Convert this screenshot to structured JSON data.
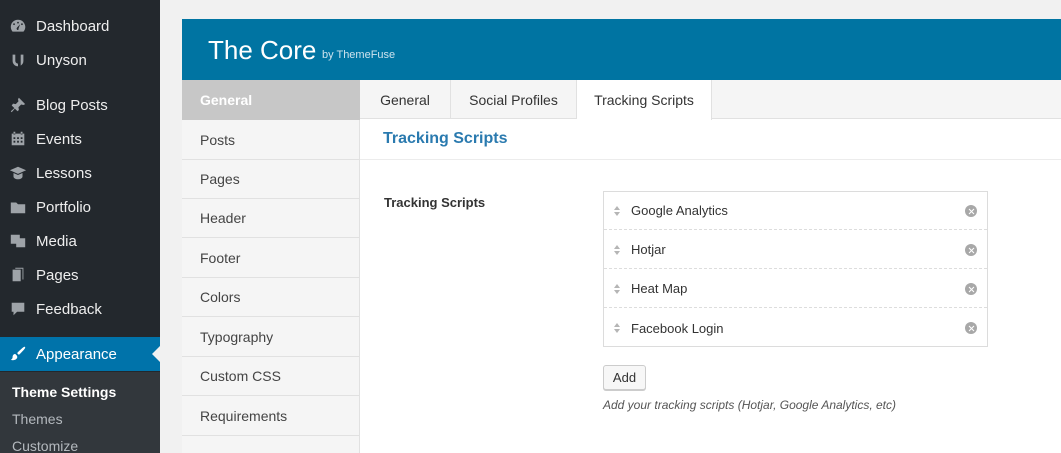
{
  "wp_menu": {
    "items": [
      {
        "label": "Dashboard",
        "icon": "dashboard-icon"
      },
      {
        "label": "Unyson",
        "icon": "unyson-icon"
      },
      {
        "label": "Blog Posts",
        "icon": "pin-icon"
      },
      {
        "label": "Events",
        "icon": "calendar-icon"
      },
      {
        "label": "Lessons",
        "icon": "graduation-cap-icon"
      },
      {
        "label": "Portfolio",
        "icon": "folder-icon"
      },
      {
        "label": "Media",
        "icon": "media-icon"
      },
      {
        "label": "Pages",
        "icon": "pages-icon"
      },
      {
        "label": "Feedback",
        "icon": "comment-icon"
      },
      {
        "label": "Appearance",
        "icon": "paintbrush-icon"
      }
    ],
    "submenu": [
      "Theme Settings",
      "Themes",
      "Customize"
    ],
    "active_color": "#0073aa"
  },
  "panel": {
    "title": "The Core",
    "subtitle": "by ThemeFuse",
    "header_color": "#0074a2",
    "left_tabs": [
      "General",
      "Posts",
      "Pages",
      "Header",
      "Footer",
      "Colors",
      "Typography",
      "Custom CSS",
      "Requirements"
    ],
    "top_tabs": [
      "General",
      "Social Profiles",
      "Tracking Scripts"
    ],
    "section_title": "Tracking Scripts",
    "field_label": "Tracking Scripts",
    "scripts": [
      "Google Analytics",
      "Hotjar",
      "Heat Map",
      "Facebook Login"
    ],
    "add_label": "Add",
    "help_text": "Add your tracking scripts (Hotjar, Google Analytics, etc)"
  }
}
